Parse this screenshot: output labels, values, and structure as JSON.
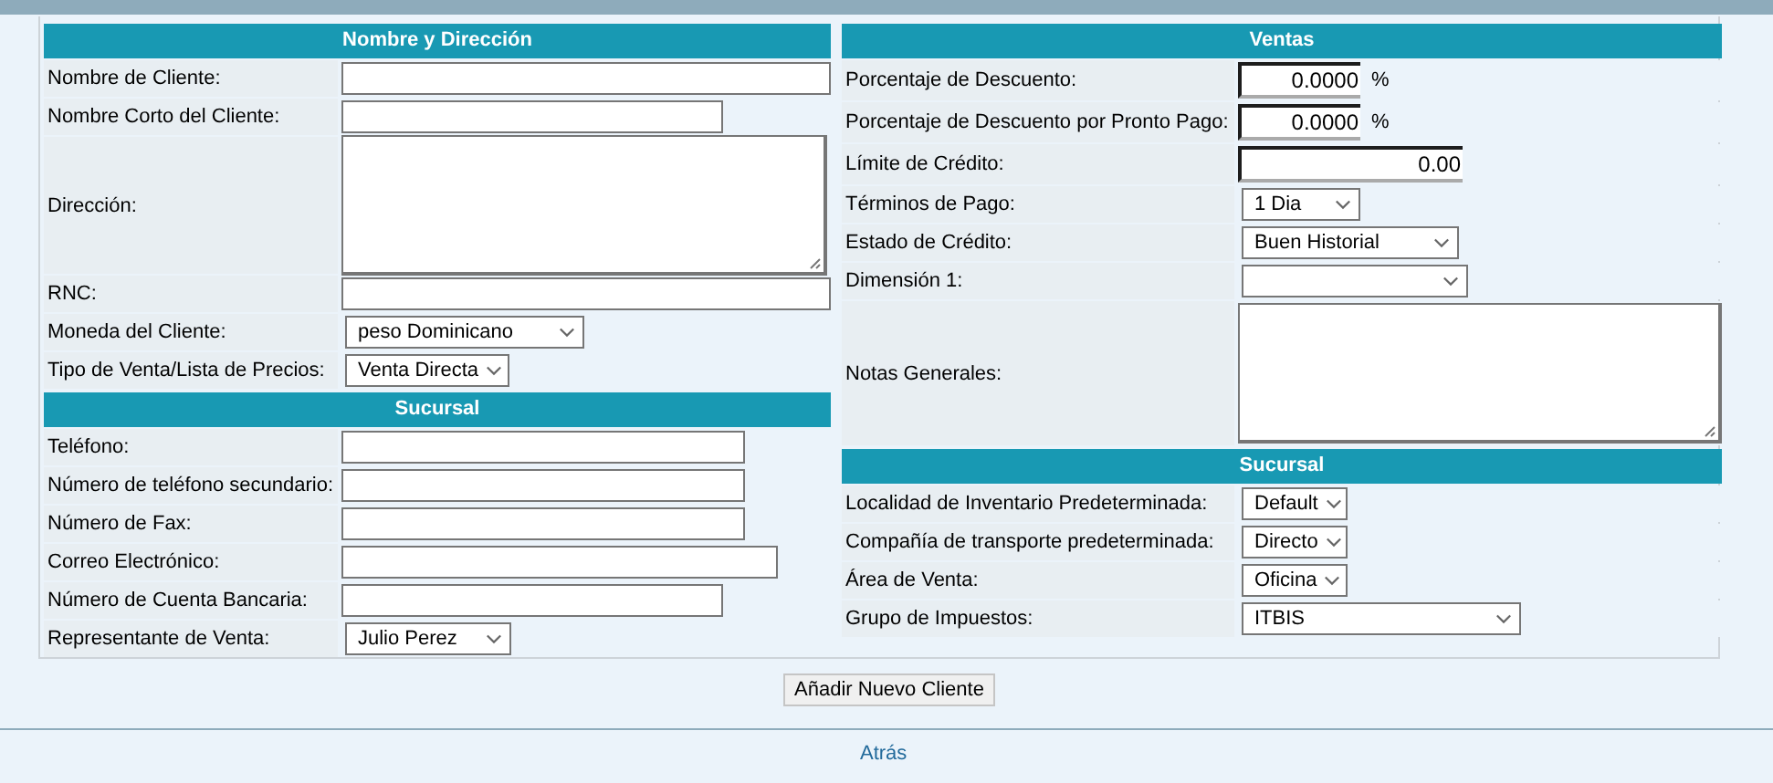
{
  "columns": [
    {
      "sections": [
        {
          "title": "Nombre y Dirección",
          "rows": [
            {
              "label": "Nombre de Cliente:",
              "kind": "text"
            },
            {
              "label": "Nombre Corto del Cliente:",
              "kind": "text"
            },
            {
              "label": "Dirección:",
              "kind": "textarea"
            },
            {
              "label": "RNC:",
              "kind": "text"
            },
            {
              "label": "Moneda del Cliente:",
              "kind": "select",
              "value": "peso Dominicano"
            },
            {
              "label": "Tipo de Venta/Lista de Precios:",
              "kind": "select",
              "value": "Venta Directa"
            }
          ]
        },
        {
          "title": "Sucursal",
          "rows": [
            {
              "label": "Teléfono:",
              "kind": "text"
            },
            {
              "label": "Número de teléfono secundario:",
              "kind": "text"
            },
            {
              "label": "Número de Fax:",
              "kind": "text"
            },
            {
              "label": "Correo Electrónico:",
              "kind": "text"
            },
            {
              "label": "Número de Cuenta Bancaria:",
              "kind": "text"
            },
            {
              "label": "Representante de Venta:",
              "kind": "select",
              "value": "Julio Perez"
            }
          ]
        }
      ]
    },
    {
      "sections": [
        {
          "title": "Ventas",
          "rows": [
            {
              "label": "Porcentaje de Descuento:",
              "kind": "number",
              "value": "0.0000",
              "suffix": "%"
            },
            {
              "label": "Porcentaje de Descuento por Pronto Pago:",
              "kind": "number",
              "value": "0.0000",
              "suffix": "%"
            },
            {
              "label": "Límite de Crédito:",
              "kind": "number",
              "value": "0.00"
            },
            {
              "label": "Términos de Pago:",
              "kind": "select",
              "value": "1 Dia"
            },
            {
              "label": "Estado de Crédito:",
              "kind": "select",
              "value": "Buen Historial"
            },
            {
              "label": "Dimensión 1:",
              "kind": "select"
            },
            {
              "label": "Notas Generales:",
              "kind": "textarea"
            }
          ]
        },
        {
          "title": "Sucursal",
          "rows": [
            {
              "label": "Localidad de Inventario Predeterminada:",
              "kind": "select",
              "value": "Default"
            },
            {
              "label": "Compañía de transporte predeterminada:",
              "kind": "select",
              "value": "Directo"
            },
            {
              "label": "Área de Venta:",
              "kind": "select",
              "value": "Oficina"
            },
            {
              "label": "Grupo de Impuestos:",
              "kind": "select",
              "value": "ITBIS"
            }
          ]
        }
      ]
    }
  ],
  "submit": "Añadir Nuevo Cliente",
  "back_link": "Atrás"
}
